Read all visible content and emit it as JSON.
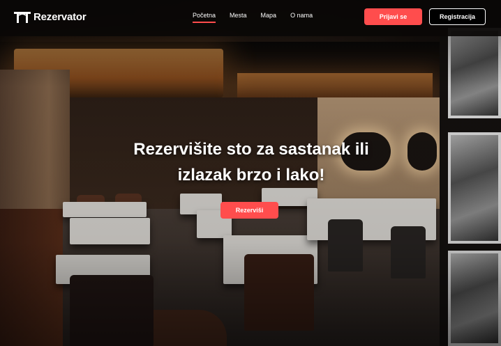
{
  "brand": {
    "name": "Rezervator",
    "icon": "gate-icon"
  },
  "nav": {
    "links": [
      {
        "label": "Početna",
        "active": true
      },
      {
        "label": "Mesta"
      },
      {
        "label": "Mapa"
      },
      {
        "label": "O nama"
      }
    ],
    "login_label": "Prijavi se",
    "register_label": "Registracija"
  },
  "hero": {
    "title_line1": "Rezervišite sto za sastanak ili",
    "title_line2": "izlazak brzo i lako!",
    "cta_label": "Rezerviši"
  },
  "colors": {
    "accent": "#ff4d4d",
    "nav_bg": "#0a0807"
  }
}
